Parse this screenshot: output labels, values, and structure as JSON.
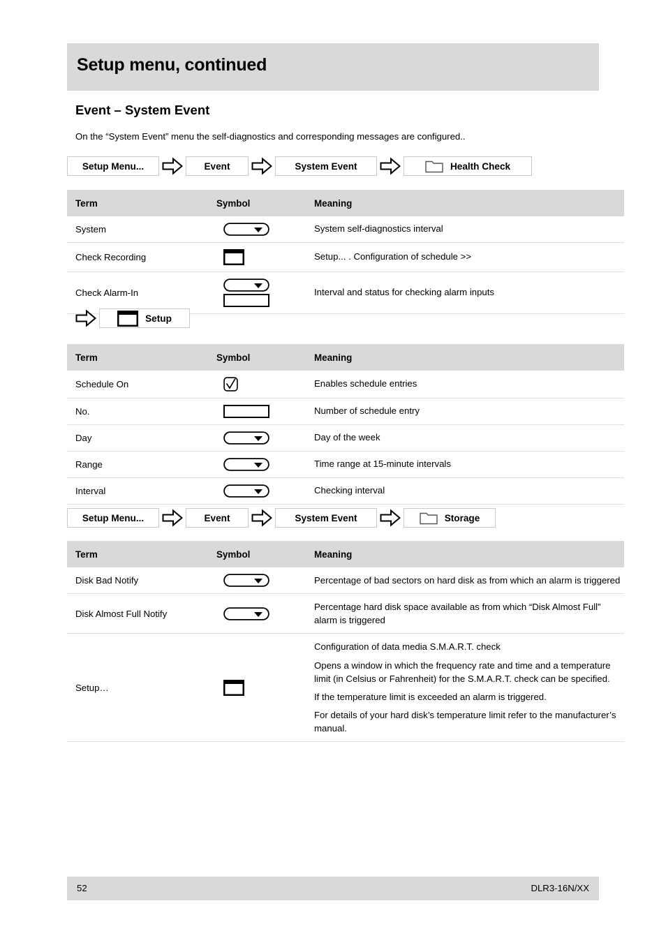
{
  "header": {
    "title": "Setup menu, continued"
  },
  "section": {
    "heading": "Event – System Event",
    "intro": "On the “System Event” menu the self-diagnostics and corresponding messages are configured.."
  },
  "breadcrumb_health": {
    "items": [
      {
        "label": "Setup Menu...",
        "icon": "none"
      },
      {
        "label": "Event",
        "icon": "none"
      },
      {
        "label": "System Event",
        "icon": "none"
      },
      {
        "label": "Health Check",
        "icon": "folder-icon"
      }
    ],
    "separator_icon": "right-arrow-icon"
  },
  "breadcrumb_storage": {
    "items": [
      {
        "label": "Setup Menu...",
        "icon": "none"
      },
      {
        "label": "Event",
        "icon": "none"
      },
      {
        "label": "System Event",
        "icon": "none"
      },
      {
        "label": "Storage",
        "icon": "folder-icon"
      }
    ],
    "separator_icon": "right-arrow-icon"
  },
  "setup_link": {
    "label": "Setup",
    "icon": "window-icon",
    "arrow_icon": "right-arrow-icon"
  },
  "table_health": {
    "columns": [
      "Term",
      "Symbol",
      "Meaning"
    ],
    "rows": [
      {
        "term": "System",
        "symbols": [
          "dropdown-icon"
        ],
        "meaning": "System self-diagnostics interval"
      },
      {
        "term": "Check Recording",
        "symbols": [
          "window-icon"
        ],
        "meaning": "Setup... . Configuration of schedule >>"
      },
      {
        "term": "Check Alarm-In",
        "symbols": [
          "dropdown-icon",
          "textbox-icon"
        ],
        "meaning": "Interval and status for checking alarm inputs"
      }
    ]
  },
  "table_schedule": {
    "columns": [
      "Term",
      "Symbol",
      "Meaning"
    ],
    "rows": [
      {
        "term": "Schedule On",
        "symbols": [
          "checkbox-checked-icon"
        ],
        "meaning": "Enables schedule entries"
      },
      {
        "term": "No.",
        "symbols": [
          "textbox-icon"
        ],
        "meaning": "Number of schedule entry"
      },
      {
        "term": "Day",
        "symbols": [
          "dropdown-icon"
        ],
        "meaning": "Day of the week"
      },
      {
        "term": "Range",
        "symbols": [
          "dropdown-icon"
        ],
        "meaning": "Time range at 15-minute intervals"
      },
      {
        "term": "Interval",
        "symbols": [
          "dropdown-icon"
        ],
        "meaning": "Checking interval"
      }
    ]
  },
  "table_storage": {
    "columns": [
      "Term",
      "Symbol",
      "Meaning"
    ],
    "rows": [
      {
        "term": "Disk Bad Notify",
        "symbols": [
          "dropdown-icon"
        ],
        "paragraphs": [
          "Percentage of bad sectors on hard disk as from which an alarm is triggered"
        ]
      },
      {
        "term": "Disk Almost Full Notify",
        "symbols": [
          "dropdown-icon"
        ],
        "paragraphs": [
          "Percentage hard disk space available as from which “Disk Almost Full” alarm is triggered"
        ]
      },
      {
        "term": "Setup…",
        "symbols": [
          "window-icon"
        ],
        "paragraphs": [
          "Configuration of data media S.M.A.R.T. check",
          "Opens a window in which the frequency rate and time and a temperature limit (in Celsius or Fahrenheit) for the S.M.A.R.T. check can be specified.",
          "If the temperature limit is exceeded an alarm is triggered.",
          "For details of your hard disk’s temperature limit refer to the manufacturer’s manual."
        ]
      }
    ]
  },
  "footer": {
    "page_number": "52",
    "model": "DLR3-16N/XX"
  },
  "colors": {
    "band_gray": "#d9d9d9",
    "rule_gray": "#e2e2e2",
    "box_border": "#c9c9c9",
    "text": "#000000"
  }
}
